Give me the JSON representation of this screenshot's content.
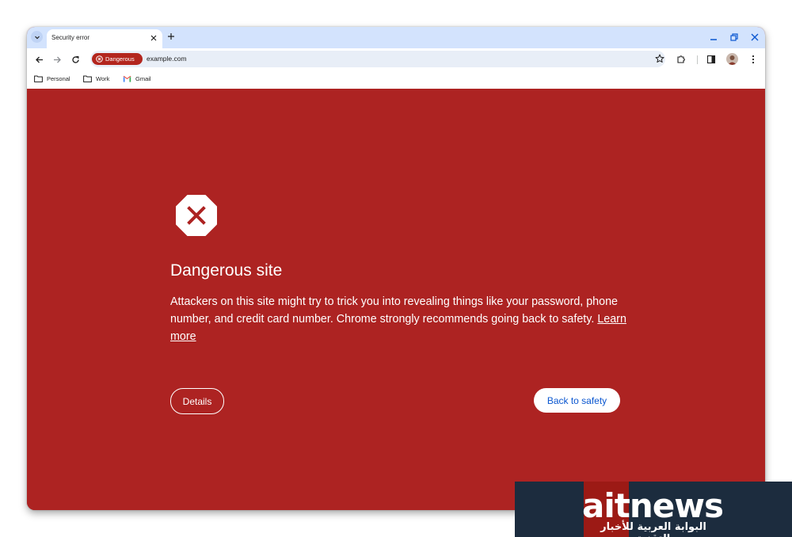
{
  "browser": {
    "tab": {
      "title": "Security error"
    },
    "chip": {
      "label": "Dangerous"
    },
    "omnibox": {
      "url": "example.com"
    },
    "bookmarks": [
      {
        "label": "Personal",
        "icon": "folder-icon"
      },
      {
        "label": "Work",
        "icon": "folder-icon"
      },
      {
        "label": "Gmail",
        "icon": "gmail-icon"
      }
    ]
  },
  "interstitial": {
    "heading": "Dangerous site",
    "description": "Attackers on this site might try to trick you into revealing things like your password, phone number, and credit card number. Chrome strongly recommends going back to safety.",
    "learn_more": "Learn more",
    "details_label": "Details",
    "back_label": "Back to safety"
  },
  "watermark": {
    "brand": "aitnews",
    "tagline": "البوابة العربية للأخبار التقنية"
  },
  "colors": {
    "danger_background": "#ad2322",
    "tabstrip": "#d3e3fd",
    "chip": "#b3261e",
    "primary_blue": "#0b57d0"
  }
}
